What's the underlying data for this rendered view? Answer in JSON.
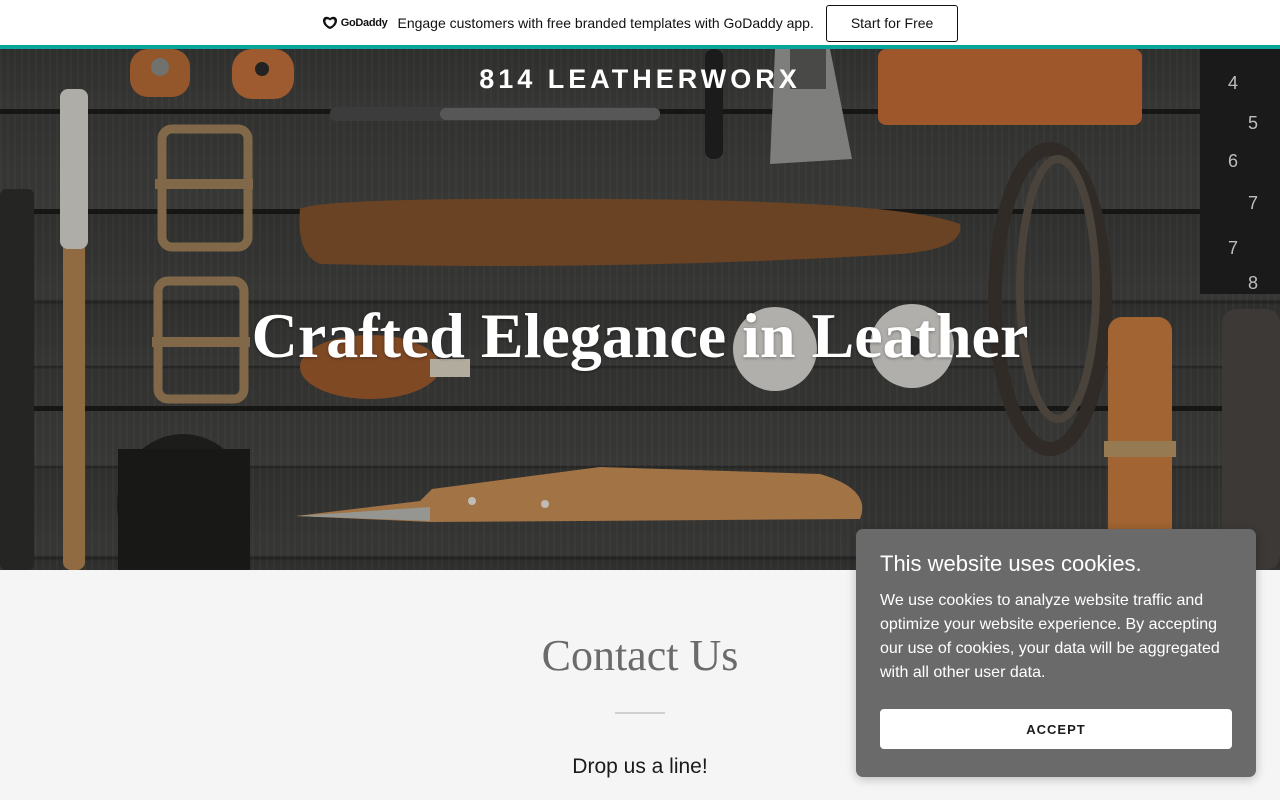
{
  "promo": {
    "logo_text": "GoDaddy",
    "message": "Engage customers with free branded templates with GoDaddy app.",
    "button_label": "Start for Free",
    "accent_color": "#09a59c"
  },
  "hero": {
    "site_title": "814 LEATHERWORX",
    "headline": "Crafted Elegance in Leather"
  },
  "contact": {
    "title": "Contact Us",
    "subtitle": "Drop us a line!"
  },
  "cookie_banner": {
    "title": "This website uses cookies.",
    "body": "We use cookies to analyze website traffic and optimize your website experience. By accepting our use of cookies, your data will be aggregated with all other user data.",
    "accept_label": "ACCEPT"
  }
}
